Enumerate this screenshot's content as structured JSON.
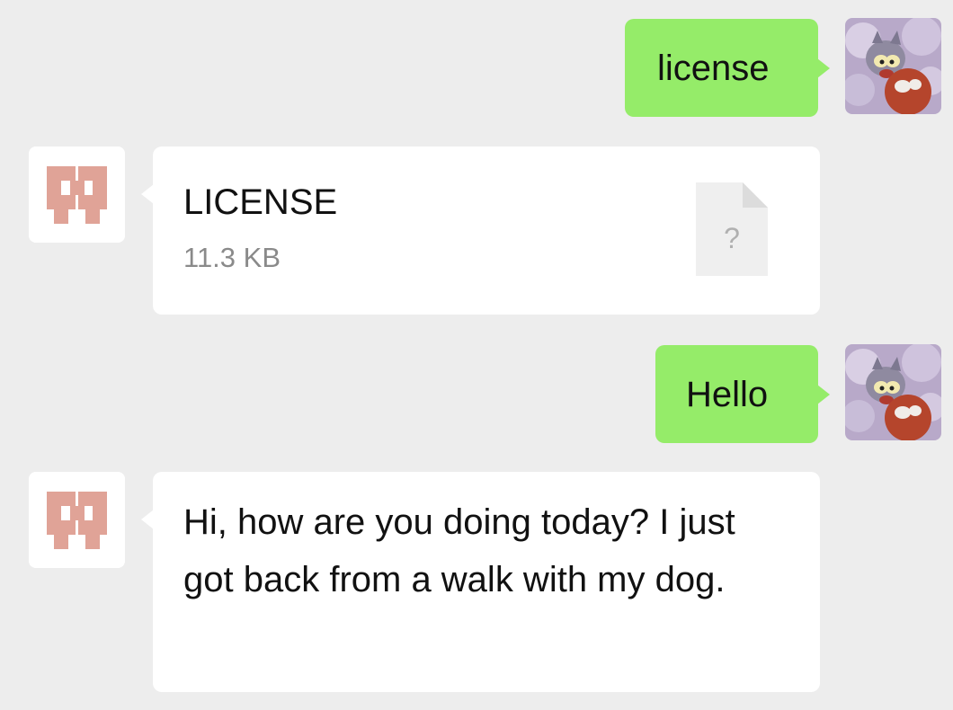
{
  "messages": [
    {
      "side": "sent",
      "kind": "text",
      "text": "license",
      "avatar": "cat-avatar"
    },
    {
      "side": "received",
      "kind": "file",
      "file_name": "LICENSE",
      "file_size": "11.3 KB",
      "file_icon_glyph": "?",
      "avatar": "pixel-identicon-avatar"
    },
    {
      "side": "sent",
      "kind": "text",
      "text": "Hello",
      "avatar": "cat-avatar"
    },
    {
      "side": "received",
      "kind": "text",
      "text": "Hi, how are you doing today? I just got back from a walk with my dog.",
      "avatar": "pixel-identicon-avatar"
    }
  ],
  "colors": {
    "background": "#ededed",
    "sent_bubble": "#95ec69",
    "received_bubble": "#ffffff",
    "identicon": "#e0a397",
    "file_size_text": "#8a8a8a"
  }
}
